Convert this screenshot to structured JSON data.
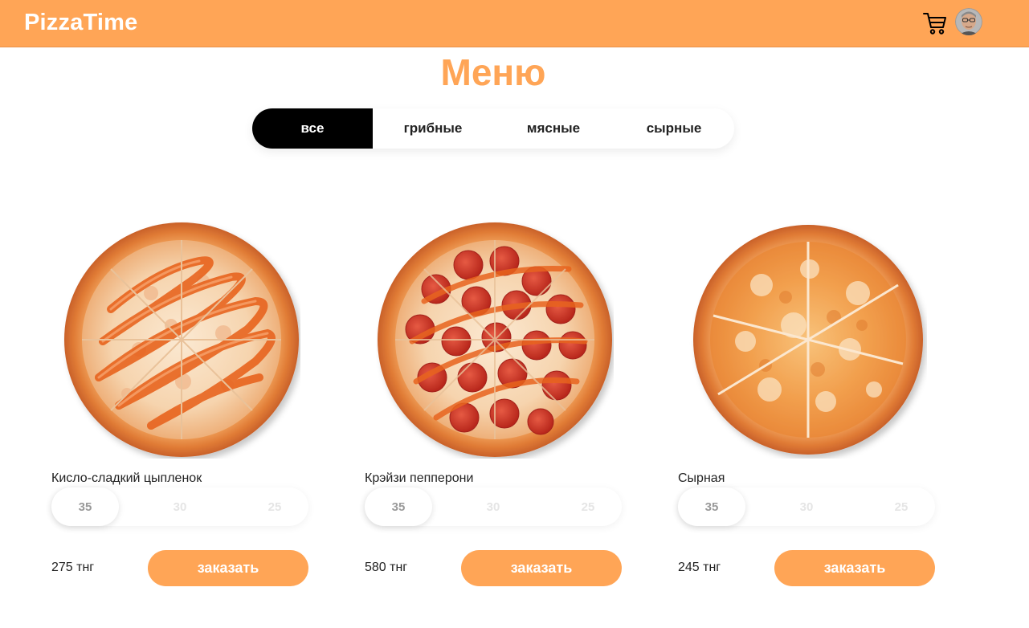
{
  "header": {
    "logo": "PizzaTime",
    "cart_icon": "shopping-cart-icon",
    "avatar_icon": "user-avatar",
    "background_color": "#ffa556"
  },
  "main": {
    "title": "Меню",
    "title_color": "#ffa556",
    "filters": [
      {
        "label": "все",
        "active": true
      },
      {
        "label": "грибные",
        "active": false
      },
      {
        "label": "мясные",
        "active": false
      },
      {
        "label": "сырные",
        "active": false
      }
    ],
    "products": [
      {
        "name": "Кисло-сладкий цыпленок",
        "sizes": [
          "35",
          "30",
          "25"
        ],
        "selected_size": "35",
        "price": "275 тнг",
        "order_label": "заказать",
        "image": "sweet-sour-chicken-pizza"
      },
      {
        "name": "Крэйзи пепперони",
        "sizes": [
          "35",
          "30",
          "25"
        ],
        "selected_size": "35",
        "price": "580 тнг",
        "order_label": "заказать",
        "image": "pepperoni-pizza"
      },
      {
        "name": "Сырная",
        "sizes": [
          "35",
          "30",
          "25"
        ],
        "selected_size": "35",
        "price": "245 тнг",
        "order_label": "заказать",
        "image": "cheese-pizza"
      }
    ],
    "accent_color": "#ffa556"
  }
}
